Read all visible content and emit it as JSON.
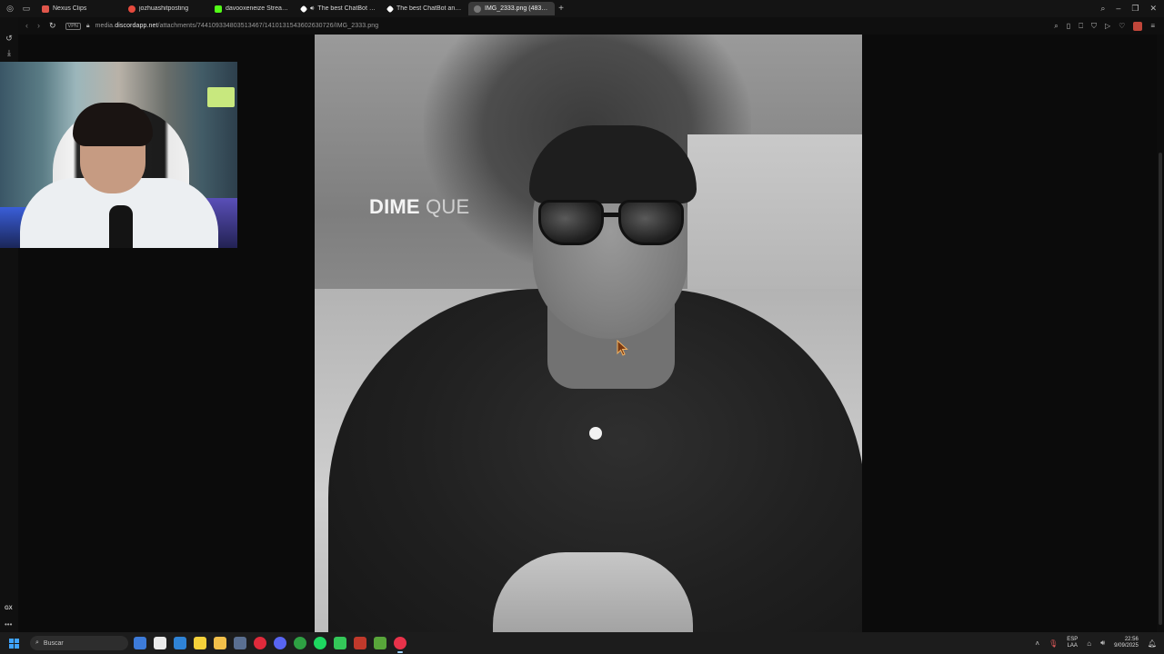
{
  "browser": {
    "tabs": [
      {
        "title": "Nexus Clips",
        "favicon_color": "#e0564b",
        "active": false
      },
      {
        "title": "jozhuashitposting",
        "favicon_color": "#e54a3d",
        "active": false
      },
      {
        "title": "davooxeneize Stream - W",
        "favicon_color": "#53fc18",
        "active": false
      },
      {
        "title": "The best ChatBot and",
        "favicon_color": "#ffffff",
        "active": false
      },
      {
        "title": "The best ChatBot and Wi",
        "favicon_color": "#ffffff",
        "active": false
      },
      {
        "title": "IMG_2333.png (483×10",
        "favicon_color": "#777777",
        "active": true
      }
    ],
    "new_tab_label": "+",
    "address": {
      "vpn_label": "VPN",
      "url_prefix": "media.",
      "url_domain": "discordapp.net",
      "url_path": "/attachments/744109334803513467/1410131543602630726/IMG_2333.png"
    }
  },
  "content": {
    "caption_word1": "DIME",
    "caption_word2": "QUE"
  },
  "sidebar": {
    "gx_label": "GX",
    "more_label": "•••"
  },
  "taskbar": {
    "search_placeholder": "Buscar",
    "language_line1": "ESP",
    "language_line2": "LAA",
    "time": "22:56",
    "date": "9/09/2025",
    "apps": [
      {
        "name": "widgets-icon",
        "color": "#3d7bd9"
      },
      {
        "name": "task-view-icon",
        "color": "#eaeaea"
      },
      {
        "name": "mail-icon",
        "color": "#2f83d6"
      },
      {
        "name": "sticky-notes-icon",
        "color": "#f5d13a"
      },
      {
        "name": "file-explorer-icon",
        "color": "#f2c04a"
      },
      {
        "name": "taskbar-app-icon",
        "color": "#5a6f91"
      },
      {
        "name": "opera-icon",
        "color": "#e02a3b"
      },
      {
        "name": "discord-icon",
        "color": "#5865f2"
      },
      {
        "name": "xbox-icon",
        "color": "#2ea043"
      },
      {
        "name": "spotify-icon",
        "color": "#1ed760"
      },
      {
        "name": "media-player-icon",
        "color": "#34c759"
      },
      {
        "name": "news-app-icon",
        "color": "#c0392b"
      },
      {
        "name": "minecraft-icon",
        "color": "#58a53a"
      },
      {
        "name": "opera-gx-icon",
        "color": "#e8324a"
      }
    ]
  }
}
